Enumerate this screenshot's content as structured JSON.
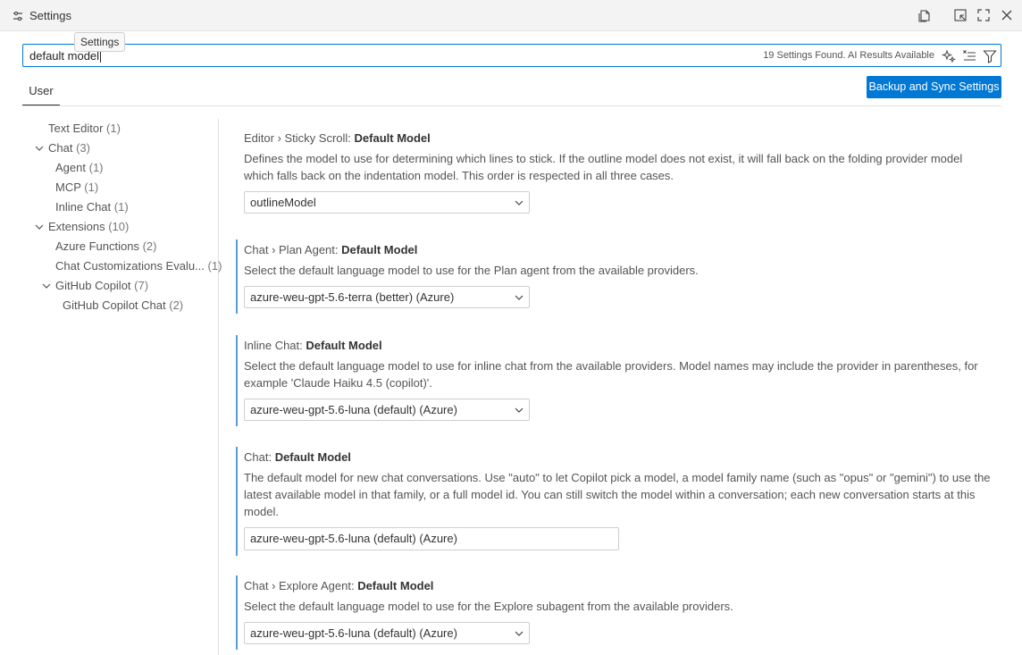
{
  "window": {
    "title": "Settings",
    "tooltip": "Settings"
  },
  "search": {
    "value": "default model",
    "results": "19 Settings Found. AI Results Available"
  },
  "tabs": {
    "user": "User"
  },
  "sync_button": "Backup and Sync Settings",
  "toc": [
    {
      "label": "Text Editor",
      "count": "(1)"
    },
    {
      "label": "Chat",
      "count": "(3)"
    },
    {
      "label": "Agent",
      "count": "(1)"
    },
    {
      "label": "MCP",
      "count": "(1)"
    },
    {
      "label": "Inline Chat",
      "count": "(1)"
    },
    {
      "label": "Extensions",
      "count": "(10)"
    },
    {
      "label": "Azure Functions",
      "count": "(2)"
    },
    {
      "label": "Chat Customizations Evalu...",
      "count": "(1)"
    },
    {
      "label": "GitHub Copilot",
      "count": "(7)"
    },
    {
      "label": "GitHub Copilot Chat",
      "count": "(2)"
    }
  ],
  "settings": [
    {
      "category": "Editor › Sticky Scroll: ",
      "name": "Default Model",
      "description": "Defines the model to use for determining which lines to stick. If the outline model does not exist, it will fall back on the folding provider model which falls back on the indentation model. This order is respected in all three cases.",
      "value": "outlineModel"
    },
    {
      "category": "Chat › Plan Agent: ",
      "name": "Default Model",
      "description": "Select the default language model to use for the Plan agent from the available providers.",
      "value": "azure-weu-gpt-5.6-terra (better) (Azure)"
    },
    {
      "category": "Inline Chat: ",
      "name": "Default Model",
      "description": "Select the default language model to use for inline chat from the available providers. Model names may include the provider in parentheses, for example 'Claude Haiku 4.5 (copilot)'.",
      "value": "azure-weu-gpt-5.6-luna (default) (Azure)"
    },
    {
      "category": "Chat: ",
      "name": "Default Model",
      "description": "The default model for new chat conversations. Use \"auto\" to let Copilot pick a model, a model family name (such as \"opus\" or \"gemini\") to use the latest available model in that family, or a full model id. You can still switch the model within a conversation; each new conversation starts at this model.",
      "value": "azure-weu-gpt-5.6-luna (default) (Azure)"
    },
    {
      "category": "Chat › Explore Agent: ",
      "name": "Default Model",
      "description": "Select the default language model to use for the Explore subagent from the available providers.",
      "value": "azure-weu-gpt-5.6-luna (default) (Azure)"
    }
  ],
  "colors": {
    "accent": "#0078d4",
    "modified_bar": "#5b9bd5"
  },
  "icons": {
    "title": "settings-sliders-icon",
    "actions": [
      "open-json-icon",
      "split-editor-icon",
      "maximize-icon",
      "close-icon"
    ],
    "search_actions": [
      "ai-sparkle-icon",
      "clear-filter-icon",
      "filter-icon"
    ]
  }
}
